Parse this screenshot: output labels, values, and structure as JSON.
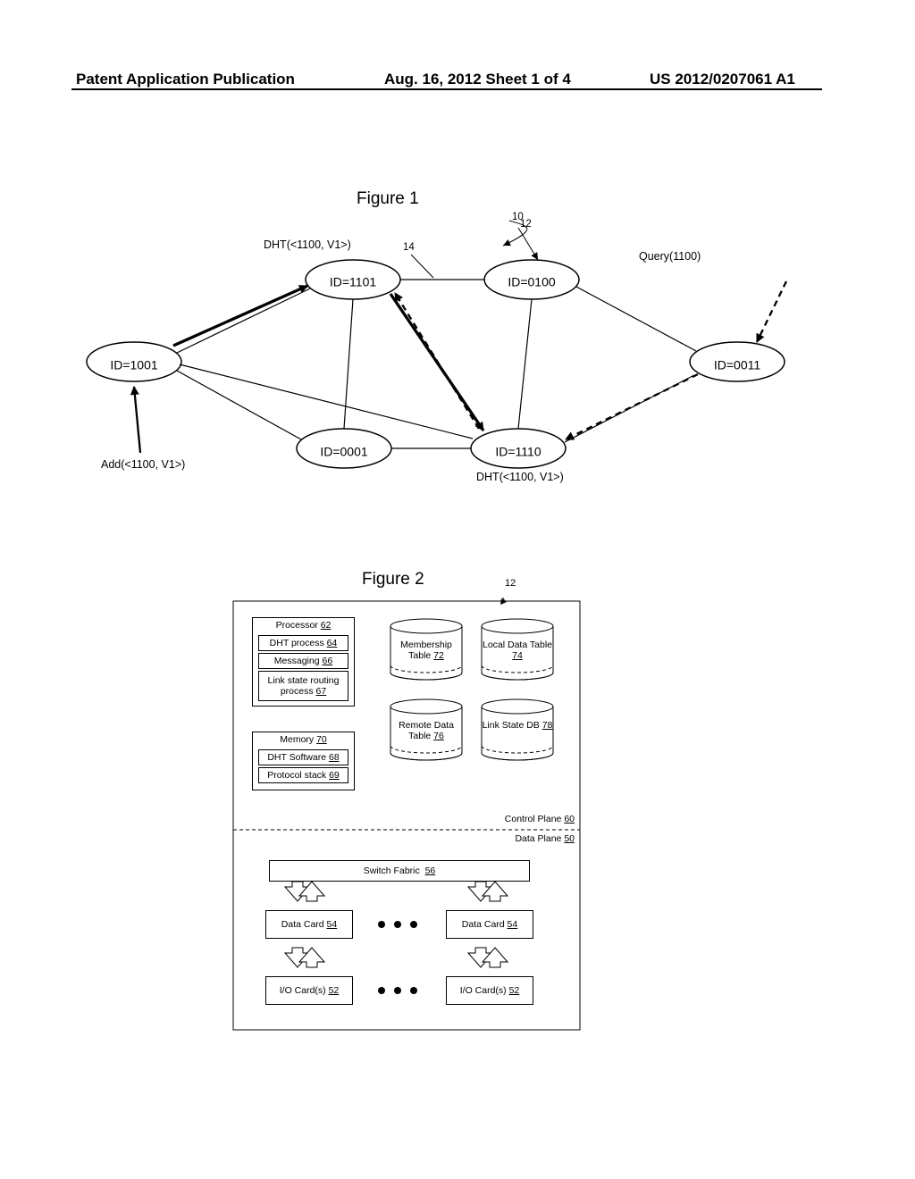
{
  "header": {
    "left": "Patent Application Publication",
    "center": "Aug. 16, 2012  Sheet 1 of 4",
    "right": "US 2012/0207061 A1"
  },
  "fig1": {
    "title": "Figure 1",
    "ref_network": "10",
    "ref_node": "12",
    "ref_link": "14",
    "nodes": {
      "n1001": "ID=1001",
      "n1101": "ID=1101",
      "n0100": "ID=0100",
      "n0011": "ID=0011",
      "n0001": "ID=0001",
      "n1110": "ID=1110"
    },
    "labels": {
      "dht1": "DHT(<1100, V1>)",
      "dht2": "DHT(<1100, V1>)",
      "add": "Add(<1100, V1>)",
      "query": "Query(1100)"
    }
  },
  "fig2": {
    "title": "Figure 2",
    "ref_node": "12",
    "processor": {
      "label": "Processor",
      "ref": "62"
    },
    "dht_process": {
      "label": "DHT process",
      "ref": "64"
    },
    "messaging": {
      "label": "Messaging",
      "ref": "66"
    },
    "link_state_routing": {
      "label": "Link state routing process",
      "ref": "67"
    },
    "memory": {
      "label": "Memory",
      "ref": "70"
    },
    "dht_sw": {
      "label": "DHT Software",
      "ref": "68"
    },
    "protocol_stack": {
      "label": "Protocol stack",
      "ref": "69"
    },
    "membership_table": {
      "label": "Membership Table",
      "ref": "72"
    },
    "local_data_table": {
      "label": "Local Data Table",
      "ref": "74"
    },
    "remote_data_table": {
      "label": "Remote Data Table",
      "ref": "76"
    },
    "link_state_db": {
      "label": "Link State DB",
      "ref": "78"
    },
    "control_plane": {
      "label": "Control Plane",
      "ref": "60"
    },
    "data_plane": {
      "label": "Data Plane",
      "ref": "50"
    },
    "switch_fabric": {
      "label": "Switch Fabric",
      "ref": "56"
    },
    "data_card": {
      "label": "Data Card",
      "ref": "54"
    },
    "io_card": {
      "label": "I/O Card(s)",
      "ref": "52"
    }
  }
}
